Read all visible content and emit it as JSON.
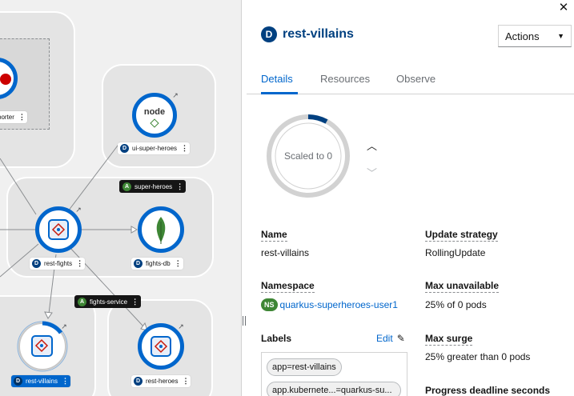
{
  "topology": {
    "nodes": {
      "partial_label": "porter",
      "ui_super_heroes": "ui-super-heroes",
      "rest_fights": "rest-fights",
      "fights_db": "fights-db",
      "rest_villains": "rest-villains",
      "rest_heroes": "rest-heroes",
      "node_logo_text": "node"
    },
    "groups": {
      "super_heroes": "super-heroes",
      "fights_service": "fights-service"
    },
    "badges": {
      "deployment": "D",
      "application": "A"
    },
    "icons": {
      "external_link": "external-link-icon",
      "kebab": "kebab-icon"
    }
  },
  "panel": {
    "title_badge": "D",
    "title": "rest-villains",
    "actions_label": "Actions",
    "tabs": [
      {
        "label": "Details",
        "active": true
      },
      {
        "label": "Resources",
        "active": false
      },
      {
        "label": "Observe",
        "active": false
      }
    ],
    "pod_status": "Scaled to 0",
    "details": {
      "name_label": "Name",
      "name_value": "rest-villains",
      "namespace_label": "Namespace",
      "namespace_badge": "NS",
      "namespace_value": "quarkus-superheroes-user1",
      "labels_label": "Labels",
      "edit_label": "Edit",
      "labels": [
        "app=rest-villains",
        "app.kubernete...=quarkus-su..."
      ],
      "update_strategy_label": "Update strategy",
      "update_strategy_value": "RollingUpdate",
      "max_unavailable_label": "Max unavailable",
      "max_unavailable_value": "25% of 0 pods",
      "max_surge_label": "Max surge",
      "max_surge_value": "25% greater than 0 pods",
      "progress_deadline_label": "Progress deadline seconds"
    }
  },
  "colors": {
    "accent": "#0066cc",
    "dark_blue": "#004080",
    "green": "#3e8635",
    "canvas": "#f0f0f0"
  }
}
